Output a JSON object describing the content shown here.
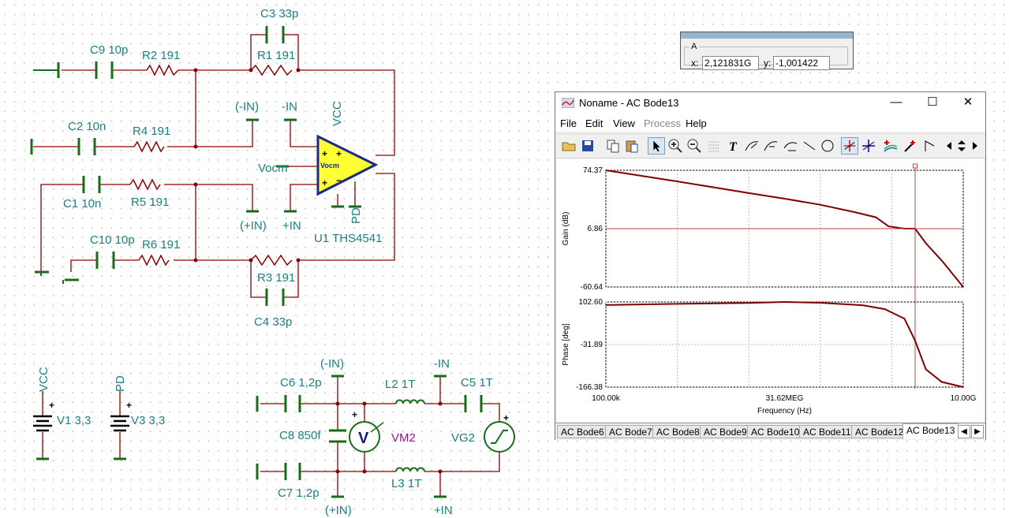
{
  "schematic": {
    "components": {
      "C3": "C3 33p",
      "R1": "R1 191",
      "C9": "C9 10p",
      "R2": "R2 191",
      "C2": "C2 10n",
      "R4": "R4 191",
      "C1": "C1 10n",
      "R5": "R5 191",
      "C10": "C10 10p",
      "R6": "R6 191",
      "R3": "R3 191",
      "C4": "C4 33p",
      "U1": "U1 THS4541",
      "V1": "V1 3,3",
      "V3": "V3 3,3",
      "C6": "C6 1,2p",
      "C7": "C7 1,2p",
      "C8": "C8 850f",
      "L2": "L2 1T",
      "L3": "L3 1T",
      "C5": "C5 1T",
      "VM2": "VM2",
      "VG2": "VG2"
    },
    "nets": {
      "neg_in": "(-IN)",
      "neg_in2": "-IN",
      "pos_in": "(+IN)",
      "pos_in2": "+IN",
      "vcc": "VCC",
      "vocm": "Vocm",
      "pd": "PD"
    },
    "opamp_label": "Vocm",
    "meter_symbol": "V"
  },
  "cursor_readout": {
    "legend": "A",
    "x_label": "x:",
    "x_value": "2,121831G",
    "y_label": "y:",
    "y_value": "-1,001422"
  },
  "bode_window": {
    "title": "Noname - AC Bode13",
    "controls": {
      "minimize": "—",
      "maximize": "☐",
      "close": "✕"
    },
    "menu": [
      "File",
      "Edit",
      "View",
      "Process",
      "Help"
    ],
    "disabled_menu": "Process",
    "tabs": [
      "AC Bode6",
      "AC Bode7",
      "AC Bode8",
      "AC Bode9",
      "AC Bode10",
      "AC Bode11",
      "AC Bode12",
      "AC Bode13"
    ],
    "active_tab": "AC Bode13",
    "icons": [
      "open-icon",
      "save-icon",
      "copy-icon",
      "paste-icon",
      "pointer-icon",
      "zoom-in-icon",
      "zoom-100-icon",
      "grid-icon",
      "text-icon",
      "curve-label-icon",
      "curve-label2-icon",
      "curve-label3-icon",
      "line-icon",
      "circle-icon",
      "cursor-a-icon",
      "cursor-b-icon",
      "curve-add-icon",
      "picker-icon",
      "marker-icon",
      "scroll-left-icon",
      "scroll-updown-icon",
      "scroll-right-icon"
    ]
  },
  "chart_data": [
    {
      "type": "line",
      "ylabel": "Gain (dB)",
      "xscale": "log",
      "xlim": [
        100000,
        10000000000
      ],
      "ylim": [
        -60.64,
        74.37
      ],
      "yticks": [
        "74.37",
        "6.86",
        "-60.64"
      ],
      "grid": true,
      "color": "#800000",
      "series": [
        {
          "x": [
            100000,
            1000000,
            10000000,
            31620000,
            100000000,
            300000000,
            600000000,
            900000000,
            1500000000,
            2121831000,
            3000000000,
            5000000000,
            10000000000
          ],
          "y": [
            74.37,
            61.5,
            48.0,
            41.5,
            34.5,
            26.0,
            20.0,
            9.5,
            6.9,
            6.86,
            -10.0,
            -30.0,
            -60.64
          ]
        }
      ],
      "cursor": {
        "x": 2121831000,
        "y": -1.001422
      }
    },
    {
      "type": "line",
      "ylabel": "Phase [deg]",
      "xlabel": "Frequency (Hz)",
      "xscale": "log",
      "xlim": [
        100000,
        10000000000
      ],
      "ylim": [
        -166.38,
        102.6
      ],
      "yticks": [
        "102.60",
        "-31.89",
        "-166.38"
      ],
      "xticks": [
        "100.00k",
        "31.62MEG",
        "10.00G"
      ],
      "grid": true,
      "color": "#800000",
      "series": [
        {
          "x": [
            100000,
            1000000,
            10000000,
            31620000,
            100000000,
            400000000,
            800000000,
            1500000000,
            2121831000,
            3000000000,
            5000000000,
            10000000000
          ],
          "y": [
            93.0,
            96.5,
            99.5,
            102.6,
            100.0,
            92.0,
            80.0,
            50.0,
            -20.0,
            -110.0,
            -150.0,
            -166.38
          ]
        }
      ]
    }
  ]
}
